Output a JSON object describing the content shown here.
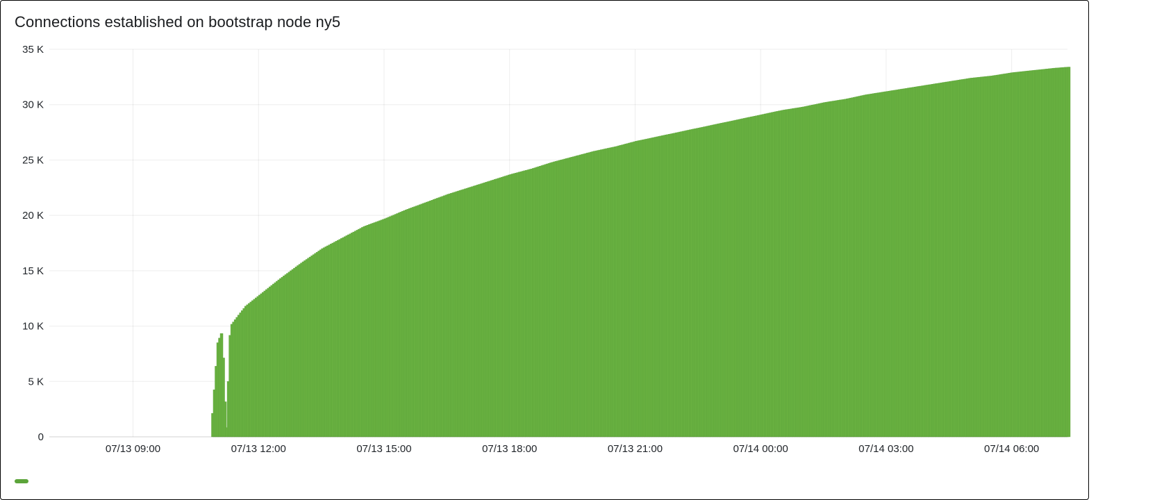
{
  "title": "Connections established on bootstrap node ny5",
  "colors": {
    "fill": "#68b040",
    "stroke": "#5ca43a",
    "swatch": "#5ca43a"
  },
  "chart_data": {
    "type": "area",
    "xlabel": "",
    "ylabel": "",
    "yticks": [
      0,
      5000,
      10000,
      15000,
      20000,
      25000,
      30000,
      35000
    ],
    "ytick_labels": [
      "0",
      "5 K",
      "10 K",
      "15 K",
      "20 K",
      "25 K",
      "30 K",
      "35 K"
    ],
    "ylim": [
      0,
      35000
    ],
    "xticks": [
      "07/13 09:00",
      "07/13 12:00",
      "07/13 15:00",
      "07/13 18:00",
      "07/13 21:00",
      "07/14 00:00",
      "07/14 03:00",
      "07/14 06:00"
    ],
    "xtick_minutes": [
      540,
      720,
      900,
      1080,
      1260,
      1440,
      1620,
      1800
    ],
    "x_range_minutes": [
      420,
      1880
    ],
    "series": [
      {
        "name": "",
        "points": [
          {
            "t": 420,
            "v": 0
          },
          {
            "t": 650,
            "v": 0
          },
          {
            "t": 660,
            "v": 8500
          },
          {
            "t": 666,
            "v": 9500
          },
          {
            "t": 672,
            "v": 0
          },
          {
            "t": 678,
            "v": 10000
          },
          {
            "t": 690,
            "v": 11000
          },
          {
            "t": 700,
            "v": 11800
          },
          {
            "t": 720,
            "v": 12800
          },
          {
            "t": 750,
            "v": 14300
          },
          {
            "t": 780,
            "v": 15700
          },
          {
            "t": 810,
            "v": 17000
          },
          {
            "t": 840,
            "v": 18000
          },
          {
            "t": 870,
            "v": 19000
          },
          {
            "t": 900,
            "v": 19700
          },
          {
            "t": 930,
            "v": 20500
          },
          {
            "t": 960,
            "v": 21200
          },
          {
            "t": 990,
            "v": 21900
          },
          {
            "t": 1020,
            "v": 22500
          },
          {
            "t": 1050,
            "v": 23100
          },
          {
            "t": 1080,
            "v": 23700
          },
          {
            "t": 1110,
            "v": 24200
          },
          {
            "t": 1140,
            "v": 24800
          },
          {
            "t": 1170,
            "v": 25300
          },
          {
            "t": 1200,
            "v": 25800
          },
          {
            "t": 1230,
            "v": 26200
          },
          {
            "t": 1260,
            "v": 26700
          },
          {
            "t": 1290,
            "v": 27100
          },
          {
            "t": 1320,
            "v": 27500
          },
          {
            "t": 1350,
            "v": 27900
          },
          {
            "t": 1380,
            "v": 28300
          },
          {
            "t": 1410,
            "v": 28700
          },
          {
            "t": 1440,
            "v": 29100
          },
          {
            "t": 1470,
            "v": 29500
          },
          {
            "t": 1500,
            "v": 29800
          },
          {
            "t": 1530,
            "v": 30200
          },
          {
            "t": 1560,
            "v": 30500
          },
          {
            "t": 1590,
            "v": 30900
          },
          {
            "t": 1620,
            "v": 31200
          },
          {
            "t": 1650,
            "v": 31500
          },
          {
            "t": 1680,
            "v": 31800
          },
          {
            "t": 1710,
            "v": 32100
          },
          {
            "t": 1740,
            "v": 32400
          },
          {
            "t": 1770,
            "v": 32600
          },
          {
            "t": 1800,
            "v": 32900
          },
          {
            "t": 1830,
            "v": 33100
          },
          {
            "t": 1860,
            "v": 33300
          },
          {
            "t": 1880,
            "v": 33400
          }
        ]
      }
    ]
  }
}
